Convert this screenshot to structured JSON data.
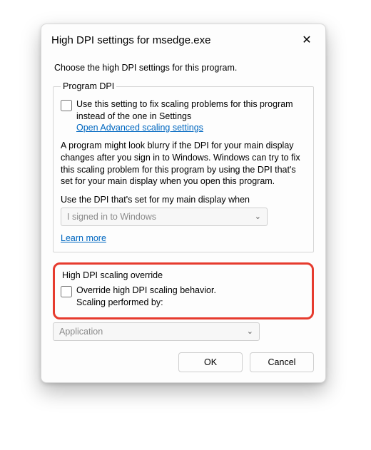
{
  "dialog": {
    "title": "High DPI settings for msedge.exe",
    "intro": "Choose the high DPI settings for this program.",
    "close_icon": "✕"
  },
  "program_dpi": {
    "legend": "Program DPI",
    "checkbox_label": "Use this setting to fix scaling problems for this program instead of the one in Settings",
    "link": "Open Advanced scaling settings",
    "blurb": "A program might look blurry if the DPI for your main display changes after you sign in to Windows. Windows can try to fix this scaling problem for this program by using the DPI that's set for your main display when you open this program.",
    "use_label": "Use the DPI that's set for my main display when",
    "select_value": "I signed in to Windows",
    "learn_more": "Learn more"
  },
  "override": {
    "legend": "High DPI scaling override",
    "checkbox_line1": "Override high DPI scaling behavior.",
    "checkbox_line2": "Scaling performed by:",
    "select_value": "Application"
  },
  "buttons": {
    "ok": "OK",
    "cancel": "Cancel"
  }
}
